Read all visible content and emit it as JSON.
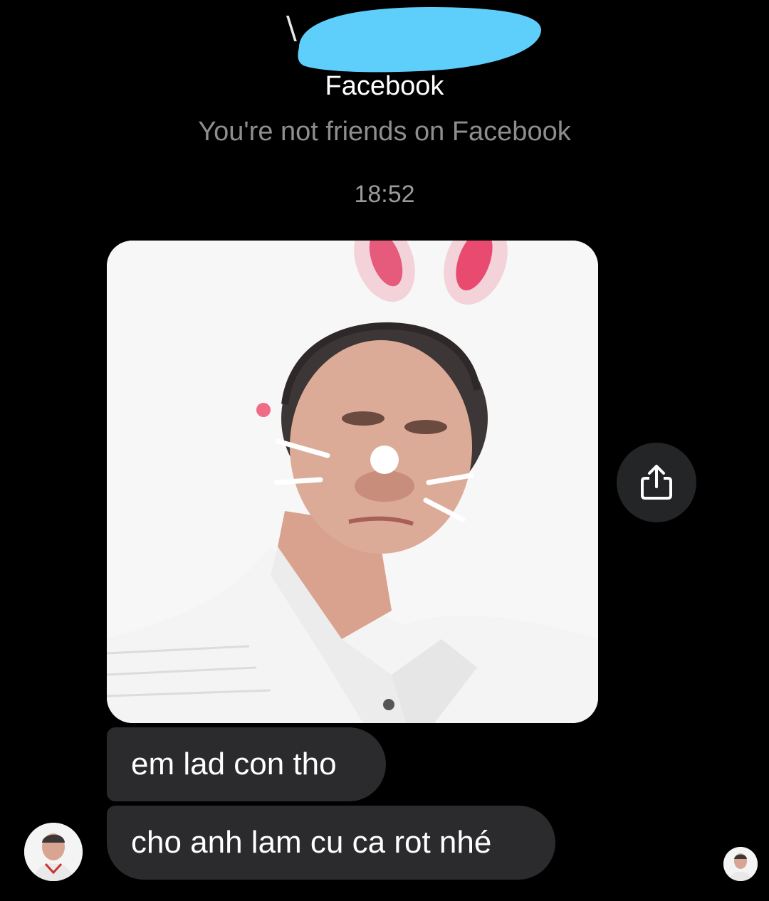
{
  "header": {
    "contact_name_initial": "\\",
    "platform_label": "Facebook",
    "friend_status": "You're not friends on Facebook"
  },
  "thread": {
    "timestamp": "18:52",
    "messages": [
      {
        "type": "photo",
        "description": "selfie with bunny ear filter"
      },
      {
        "type": "text",
        "text": "em lad con tho"
      },
      {
        "type": "text",
        "text": "cho anh lam cu ca rot nhé"
      }
    ]
  },
  "icons": {
    "share": "share-icon",
    "redaction": "redaction-blob"
  },
  "colors": {
    "background": "#000000",
    "bubble": "#2b2b2d",
    "redaction": "#5ecffb",
    "secondary_text": "#8e8e8e"
  }
}
